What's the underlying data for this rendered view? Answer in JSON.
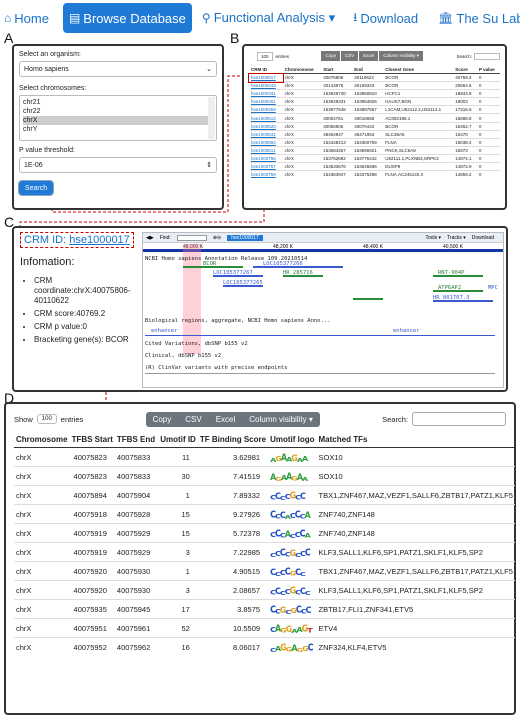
{
  "nav": [
    {
      "icon": "home-icon",
      "label": "Home",
      "active": false
    },
    {
      "icon": "table-icon",
      "label": "Browse Database",
      "active": true
    },
    {
      "icon": "search-icon",
      "label": "Functional Analysis ▾",
      "active": false
    },
    {
      "icon": "download-icon",
      "label": "Download",
      "active": false
    },
    {
      "icon": "building-icon",
      "label": "The Su Lab",
      "active": false
    }
  ],
  "letters": {
    "a": "A",
    "b": "B",
    "c": "C",
    "d": "D"
  },
  "panelA": {
    "organism_label": "Select an organism:",
    "organism_value": "Homo sapiens",
    "chrom_label": "Select chromosomes:",
    "chromosomes": [
      "chr21",
      "chr22",
      "chrX",
      "chrY"
    ],
    "selected_chromosome": "chrX",
    "pvalue_label": "P value threshold:",
    "pvalue_value": "1E-06",
    "search_button": "Search"
  },
  "panelB": {
    "entries_value": "100",
    "entries_label": "entries",
    "buttons": [
      "Copy",
      "CSV",
      "Excel",
      "Column visibility ▾"
    ],
    "search_label": "Search:",
    "columns": [
      "CRM ID",
      "Chromosome",
      "Start",
      "End",
      "Closest Gene",
      "Score",
      "P value"
    ],
    "rows": [
      [
        "hse1000017",
        "chrX",
        "40075806",
        "40110622",
        "BCOR",
        "40769.2",
        "0"
      ],
      [
        "hse1000243",
        "chrX",
        "40143976",
        "40159333",
        "BCOR",
        "20664.6",
        "0"
      ],
      [
        "hse1000331",
        "chrX",
        "153945740",
        "153960810",
        "HCFC1",
        "18844.9",
        "0"
      ],
      [
        "hse1000401",
        "chrX",
        "153949331",
        "153954826",
        "HAUS7,BGN",
        "18003",
        "0"
      ],
      [
        "hse1000459",
        "chrX",
        "153877648",
        "153887667",
        "L1CAM,U52112.2,U52112.1",
        "17216.6",
        "0"
      ],
      [
        "hse1000512",
        "chrX",
        "40002761",
        "40016555",
        "AC092198.1",
        "16688.8",
        "0"
      ],
      [
        "hse1000520",
        "chrX",
        "40056806",
        "40070442",
        "BCOR",
        "16452.7",
        "0"
      ],
      [
        "hse1000541",
        "chrX",
        "48464947",
        "48471953",
        "SLC38A5",
        "16470",
        "0"
      ],
      [
        "hse1000594",
        "chrX",
        "154348213",
        "154360759",
        "FLNA",
        "16038.4",
        "0"
      ],
      [
        "hse1000611",
        "chrX",
        "153684257",
        "153696921",
        "PNCK,SLC6A8",
        "15873",
        "0"
      ],
      [
        "hse1000766",
        "chrX",
        "153762692",
        "153776442",
        "U52111.1,PLXNB3,SRPK3",
        "14874.1",
        "0"
      ],
      [
        "hse1000767",
        "chrX",
        "153633676",
        "153645596",
        "DUSP9",
        "14872.9",
        "0"
      ],
      [
        "hse1000769",
        "chrX",
        "154363947",
        "154375298",
        "FLNA,AC245140.3",
        "14859.2",
        "0"
      ]
    ]
  },
  "panelC": {
    "crm_label": "CRM ID: ",
    "crm_id": "hse1000017",
    "info_title": "Infomation:",
    "info": [
      "CRM coordinate:chrX:40075806-40110622",
      "CRM score:40769.2",
      "CRM p value:0",
      "Bracketing gene(s): BCOR"
    ],
    "browser": {
      "find_label": "Find:",
      "locus": "hse1000017",
      "scale_labels": [
        "48,000 K",
        "48,200 K",
        "48,400 K",
        "40,500 K"
      ],
      "tools_label": "Tools ▾",
      "tracks_label": "Tracks ▾",
      "download_label": "Download",
      "annotation_title": "NCBI Homo sapiens Annotation Release 109.20210514",
      "genes": [
        "BCOR",
        "LOC105377266",
        "LOC105377267",
        "LOC105377265",
        "HR_285716",
        "RN7-904P",
        "ATP6AP2",
        "HR_001707.3",
        "MPC"
      ],
      "tracks": [
        "Biological regions, aggregate, NCBI Homo sapiens Anno...",
        "enhancer",
        "Cited Variations, dbSNP b155 v2",
        "Clinical, dbSNP b155 v2",
        "(R) ClinVar variants with precise endpoints"
      ]
    }
  },
  "panelD": {
    "show_label": "Show",
    "entries_value": "100",
    "entries_label": "entries",
    "buttons": [
      "Copy",
      "CSV",
      "Excel",
      "Column visibility ▾"
    ],
    "search_label": "Search:",
    "columns": [
      "Chromosome",
      "TFBS Start",
      "TFBS End",
      "Umotif ID",
      "TF Binding Score",
      "Umotif logo",
      "Matched TFs"
    ],
    "rows": [
      {
        "chr": "chrX",
        "start": "40075823",
        "end": "40075833",
        "id": "11",
        "score": "3.62981",
        "logo": "AGAAGAA",
        "tfs": "SOX10"
      },
      {
        "chr": "chrX",
        "start": "40075823",
        "end": "40075833",
        "id": "30",
        "score": "7.41519",
        "logo": "AGAAGAA",
        "tfs": "SOX10"
      },
      {
        "chr": "chrX",
        "start": "40075894",
        "end": "40075904",
        "id": "1",
        "score": "7.89332",
        "logo": "CCCCGCC",
        "tfs": "TBX1,ZNF467,MAZ,VEZF1,SALLF6,ZBTB17,PATZ1,KLF5"
      },
      {
        "chr": "chrX",
        "start": "40075918",
        "end": "40075928",
        "id": "15",
        "score": "9.27926",
        "logo": "CCCACCCA",
        "tfs": "ZNF740,ZNF148"
      },
      {
        "chr": "chrX",
        "start": "40075919",
        "end": "40075929",
        "id": "15",
        "score": "5.72378",
        "logo": "CCCACCCA",
        "tfs": "ZNF740,ZNF148"
      },
      {
        "chr": "chrX",
        "start": "40075919",
        "end": "40075929",
        "id": "3",
        "score": "7.22985",
        "logo": "CCCCGCCC",
        "tfs": "KLF3,SALL1,KLF6,SP1,PATZ1,SKLF1,KLF5,SP2"
      },
      {
        "chr": "chrX",
        "start": "40075920",
        "end": "40075930",
        "id": "1",
        "score": "4.90515",
        "logo": "CCCCGCC",
        "tfs": "TBX1,ZNF467,MAZ,VEZF1,SALLF6,ZBTB17,PATZ1,KLF5"
      },
      {
        "chr": "chrX",
        "start": "40075920",
        "end": "40075930",
        "id": "3",
        "score": "2.08657",
        "logo": "CCCCGCCC",
        "tfs": "KLF3,SALL1,KLF6,SP1,PATZ1,SKLF1,KLF5,SP2"
      },
      {
        "chr": "chrX",
        "start": "40075935",
        "end": "40075945",
        "id": "17",
        "score": "3.8575",
        "logo": "CCGCGCCC",
        "tfs": "ZBTB17,FLI1,ZNF341,ETV5"
      },
      {
        "chr": "chrX",
        "start": "40075951",
        "end": "40075961",
        "id": "52",
        "score": "10.5509",
        "logo": "CAGGAAGT",
        "tfs": "ETV4"
      },
      {
        "chr": "chrX",
        "start": "40075952",
        "end": "40075962",
        "id": "16",
        "score": "8.06017",
        "logo": "CAGGAGGC",
        "tfs": "ZNF324,KLF4,ETV5"
      }
    ]
  }
}
